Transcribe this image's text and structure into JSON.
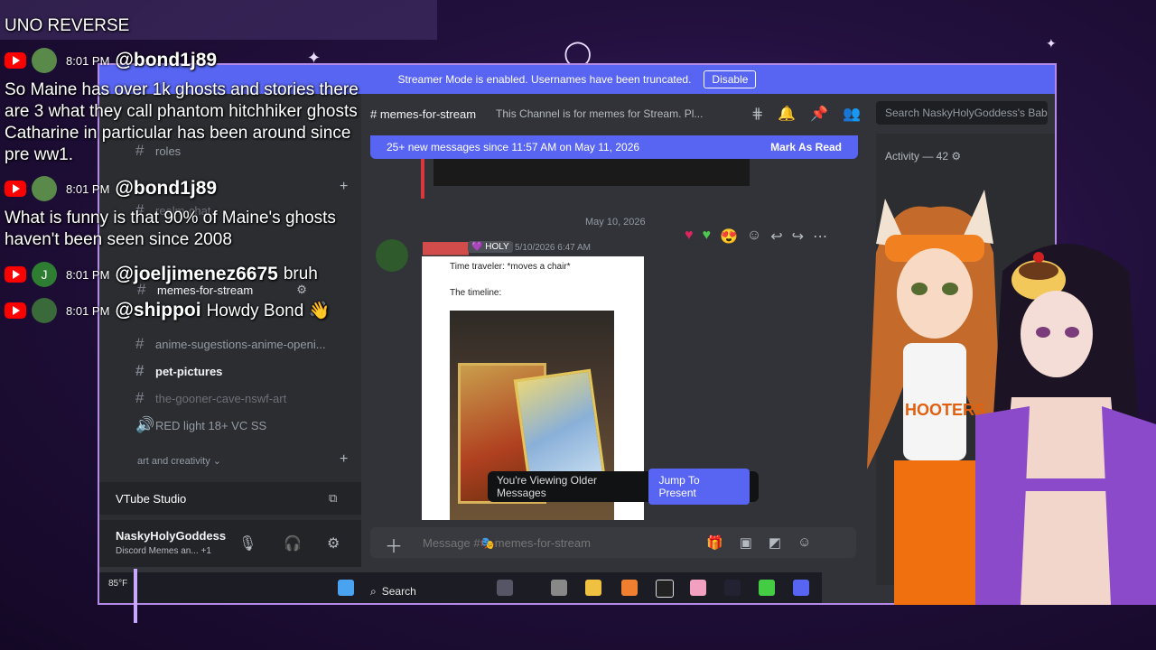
{
  "chat_overlay": {
    "header_text": "UNO REVERSE",
    "messages": [
      {
        "time": "8:01 PM",
        "user": "@bond1j89",
        "lines": [
          "So Maine has over 1k ghosts and stories there",
          "are 3 what they call phantom hitchhiker ghosts",
          "Catharine in particular has been around since",
          "pre ww1."
        ]
      },
      {
        "time": "8:01 PM",
        "user": "@bond1j89",
        "lines": [
          "What is funny is that 90% of Maine's ghosts",
          "haven't been seen since 2008"
        ]
      },
      {
        "time": "8:01 PM",
        "user": "@joeljimenez6675",
        "avatar_letter": "J",
        "inline": "bruh"
      },
      {
        "time": "8:01 PM",
        "user": "@shippoi",
        "inline": "Howdy Bond 👋"
      }
    ]
  },
  "discord": {
    "streamer_mode": {
      "text": "Streamer Mode is enabled. Usernames have been truncated.",
      "button": "Disable"
    },
    "channel_header": {
      "name": "memes-for-stream",
      "topic": "This Channel is for memes for Stream. Pl..."
    },
    "search_placeholder": "Search NaskyHolyGoddess's Bab...",
    "new_messages": {
      "text": "25+ new messages since 11:57 AM on May 11, 2026",
      "action": "Mark As Read"
    },
    "sidebar": {
      "channels": [
        {
          "name": "roles"
        },
        {
          "name": "realm-chat"
        },
        {
          "name": "memes-for-stream"
        },
        {
          "name": "anime-sugestions-anime-openi..."
        },
        {
          "name": "pet-pictures"
        },
        {
          "name": "the-gooner-cave-nswf-art"
        },
        {
          "name": "RED light 18+ VC SS"
        }
      ],
      "category": "art and creativity"
    },
    "vtube_studio": "VTube Studio",
    "user": {
      "name": "NaskyHolyGoddess",
      "status": "Discord Memes an...",
      "status_extra": "+1"
    },
    "message": {
      "date_divider": "May 10, 2026",
      "badge": "HOLY",
      "timestamp": "5/10/2026 6:47 AM",
      "meme_line1": "Time traveler: *moves a chair*",
      "meme_line2": "The timeline:"
    },
    "older_messages": {
      "text": "You're Viewing Older Messages",
      "button": "Jump To Present"
    },
    "composer_placeholder": "Message #🎭memes-for-stream",
    "activity": "Activity — 42"
  },
  "taskbar": {
    "search_label": "Search",
    "weather": "85°F"
  },
  "colors": {
    "blurple": "#5865f2",
    "frame": "#b38ae8",
    "discord_bg": "#313338",
    "sidebar_bg": "#2b2d31"
  }
}
